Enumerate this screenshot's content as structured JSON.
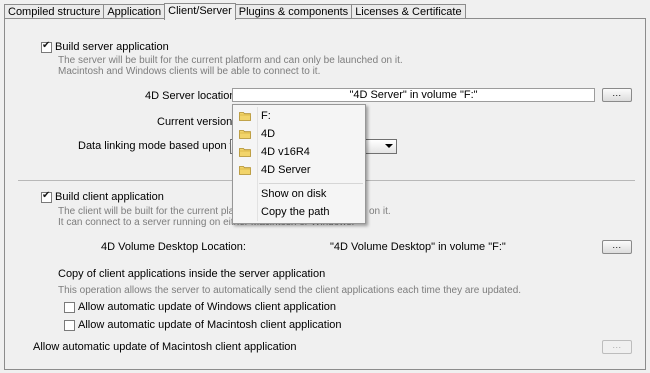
{
  "tabs": [
    "Compiled structure",
    "Application",
    "Client/Server",
    "Plugins & components",
    "Licenses & Certificate"
  ],
  "server": {
    "build_label": "Build server application",
    "desc1": "The server will be built for the current platform and can only be launched on it.",
    "desc2": "Macintosh and Windows clients will be able to connect to it.",
    "location_label": "4D Server location:",
    "location_value": "\"4D Server\" in volume \"F:\"",
    "browse_label": "...",
    "version_label": "Current version:",
    "linking_label": "Data linking mode based upon the"
  },
  "popup": {
    "items": [
      "F:",
      "4D",
      "4D v16R4",
      "4D Server"
    ],
    "actions": [
      "Show on disk",
      "Copy the path"
    ]
  },
  "client": {
    "build_label": "Build client application",
    "desc1_left": "The client will be built for the current plat",
    "desc1_right": "on it.",
    "desc2": "It can connect to a server running on either Macintosh or Windows.",
    "location_label": "4D Volume Desktop Location:",
    "location_value": "\"4D Volume Desktop\" in volume \"F:\"",
    "browse_label": "..."
  },
  "copy": {
    "title": "Copy of client applications inside the server application",
    "desc": "This operation allows the server to automatically send the client applications each time they are updated.",
    "win_label": "Allow automatic update of Windows client application",
    "mac_label": "Allow automatic update of Macintosh client application"
  },
  "bottom": {
    "label": "Allow automatic update of Macintosh client application",
    "browse_label": "..."
  }
}
